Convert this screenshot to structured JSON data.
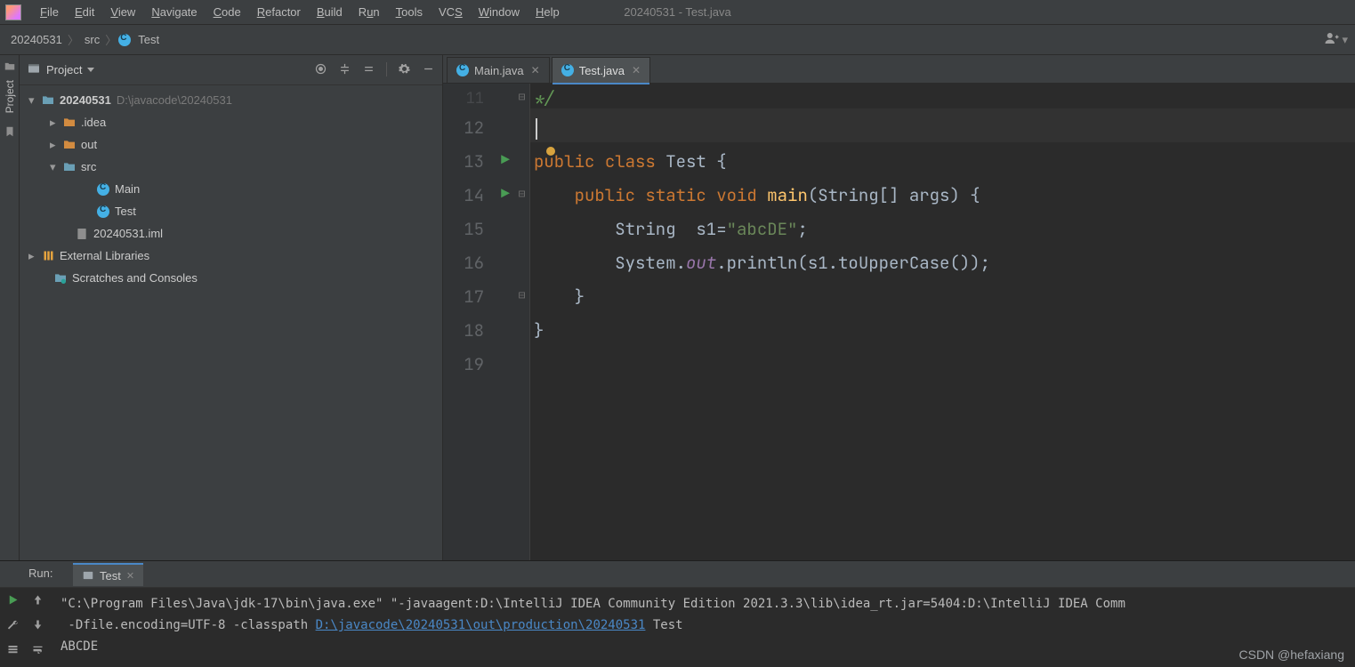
{
  "window": {
    "title": "20240531 - Test.java"
  },
  "menu": {
    "items": [
      "File",
      "Edit",
      "View",
      "Navigate",
      "Code",
      "Refactor",
      "Build",
      "Run",
      "Tools",
      "VCS",
      "Window",
      "Help"
    ]
  },
  "breadcrumb": {
    "project": "20240531",
    "folder": "src",
    "file": "Test"
  },
  "project_panel": {
    "title": "Project",
    "tree": {
      "root": {
        "name": "20240531",
        "path": "D:\\javacode\\20240531"
      },
      "idea": ".idea",
      "out": "out",
      "src": "src",
      "main": "Main",
      "test": "Test",
      "iml": "20240531.iml",
      "ext": "External Libraries",
      "scratch": "Scratches and Consoles"
    }
  },
  "tabs": {
    "main": "Main.java",
    "test": "Test.java"
  },
  "editor": {
    "line_start": 11,
    "l11": "*/",
    "l13_kw1": "public",
    "l13_kw2": "class",
    "l13_name": "Test",
    "l13_tail": " {",
    "l14_kw1": "public",
    "l14_kw2": "static",
    "l14_kw3": "void",
    "l14_fn": "main",
    "l14_args": "(String[] args) {",
    "l15_type": "String",
    "l15_var": "  s1=",
    "l15_str": "\"abcDE\"",
    "l15_tail": ";",
    "l16_a": "System.",
    "l16_out": "out",
    "l16_b": ".println(s1.toUpperCase());",
    "l17": "    }",
    "l18": "}"
  },
  "run": {
    "label": "Run:",
    "tab": "Test",
    "out_line1_a": "\"C:\\Program Files\\Java\\jdk-17\\bin\\java.exe\" \"-javaagent:D:\\IntelliJ IDEA Community Edition 2021.3.3\\lib\\idea_rt.jar=5404:D:\\IntelliJ IDEA Comm",
    "out_line2_a": " -Dfile.encoding=UTF-8 -classpath ",
    "out_line2_link": "D:\\javacode\\20240531\\out\\production\\20240531",
    "out_line2_b": " Test",
    "out_line3": "ABCDE"
  },
  "sidebar": {
    "label": "Project"
  },
  "watermark": "CSDN @hefaxiang"
}
